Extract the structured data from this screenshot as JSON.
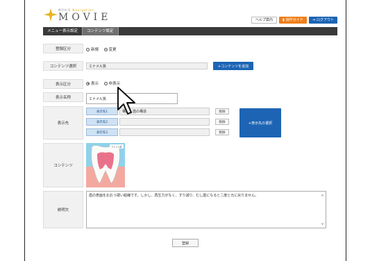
{
  "header": {
    "logo_sub": "MOVIE",
    "logo_sub_accent": "Navigation",
    "logo_text": "MOVIE",
    "help_label": "ヘルプ案内",
    "guide_label": "操作ガイド",
    "logout_label": "ログアウト"
  },
  "tabs": [
    {
      "label": "メニュー表示設定"
    },
    {
      "label": "コンテンツ設定"
    }
  ],
  "form": {
    "reg_type": {
      "label": "登録区分",
      "options": [
        "新規",
        "変更"
      ]
    },
    "content_select": {
      "label": "コンテンツ選択",
      "value": "エナメル質",
      "button": "+コンテンツを追加"
    },
    "display_type": {
      "label": "表示区分",
      "options": [
        "表示",
        "非表示"
      ]
    },
    "display_name": {
      "label": "表示名称",
      "value": "エナメル質"
    },
    "destination": {
      "label": "表示先",
      "items": [
        {
          "tag": "表示先1",
          "value": "構造 - 歯の構造",
          "delete": "削除"
        },
        {
          "tag": "表示先2",
          "value": "",
          "delete": "削除"
        },
        {
          "tag": "表示先3",
          "value": "",
          "delete": "削除"
        }
      ],
      "add_button": "+表示先の選択"
    },
    "content": {
      "label": "コンテンツ",
      "image_tag": "エナメル質"
    },
    "description": {
      "label": "説明文",
      "value": "歯の表面をおおう硬い組織です。しかし、再生力がなく、すり減り、むし歯になると二度と元に戻りません。"
    },
    "register_button": "登録"
  }
}
